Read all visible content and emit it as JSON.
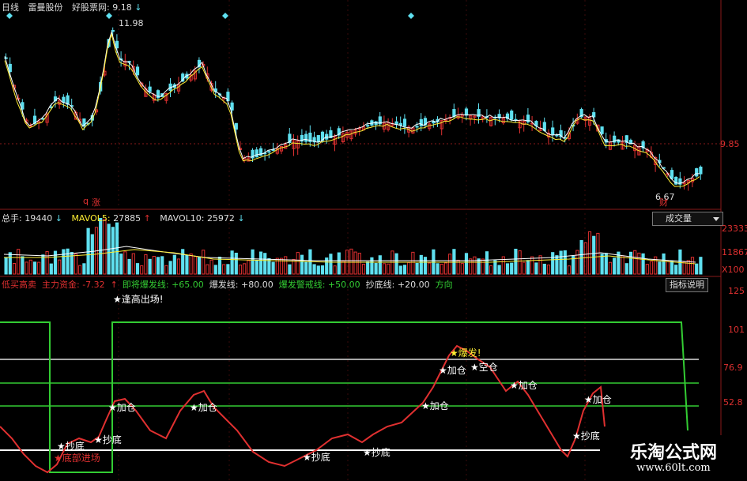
{
  "header": {
    "period": "日线",
    "stock": "雷曼股份",
    "site": "好股票网:",
    "price": "9.18",
    "price_arrow": "↓",
    "high_label": "11.98",
    "low_label": "6.67",
    "right_price": "9.85",
    "q_mark": "q",
    "rise_mark": "涨",
    "fall_mark": "财"
  },
  "volume": {
    "total_label": "总手:",
    "total_value": "19440",
    "total_arrow": "↓",
    "mavol5_label": "MAVOL5:",
    "mavol5_value": "27885",
    "mavol5_arrow": "↑",
    "mavol10_label": "MAVOL10:",
    "mavol10_value": "25972",
    "mavol10_arrow": "↓",
    "button_label": "成交量",
    "axis": [
      "23333",
      "11867",
      "X100"
    ]
  },
  "indicator": {
    "items": [
      {
        "label": "低买高卖",
        "color": "#e03030"
      },
      {
        "label": "主力资金: -7.32",
        "color": "#e03030"
      },
      {
        "label": "↑",
        "color": "#e03030"
      },
      {
        "label": "即将爆发线: +65.00",
        "color": "#33cc33"
      },
      {
        "label": "爆发线: +80.00",
        "color": "#dddddd"
      },
      {
        "label": "爆发警戒线: +50.00",
        "color": "#33cc33"
      },
      {
        "label": "抄底线: +20.00",
        "color": "#dddddd"
      },
      {
        "label": "方向",
        "color": "#33cc33"
      }
    ],
    "button_label": "指标说明",
    "axis": [
      "125",
      "101",
      "76.9",
      "52.8"
    ],
    "signals": [
      {
        "text": "★逢高出场!",
        "color": "#ffffff"
      },
      {
        "text": "★抄底",
        "color": "#ffffff"
      },
      {
        "text": "★底部进场",
        "color": "#e03030"
      },
      {
        "text": "★抄底",
        "color": "#ffffff"
      },
      {
        "text": "★加仓",
        "color": "#ffffff"
      },
      {
        "text": "★加仓",
        "color": "#ffffff"
      },
      {
        "text": "★抄底",
        "color": "#ffffff"
      },
      {
        "text": "★抄底",
        "color": "#ffffff"
      },
      {
        "text": "★加仓",
        "color": "#ffffff"
      },
      {
        "text": "★加仓",
        "color": "#ffffff"
      },
      {
        "text": "★爆发!",
        "color": "#ffee33"
      },
      {
        "text": "★空仓",
        "color": "#ffffff"
      },
      {
        "text": "★加仓",
        "color": "#ffffff"
      },
      {
        "text": "★加仓",
        "color": "#ffffff"
      },
      {
        "text": "★抄底",
        "color": "#ffffff"
      }
    ]
  },
  "watermark": {
    "title": "乐淘公式网",
    "url": "www.60lt.com"
  },
  "colors": {
    "up": "#e03030",
    "down": "#5fe0f0",
    "green": "#33cc33",
    "grid": "#8a1a1a"
  }
}
